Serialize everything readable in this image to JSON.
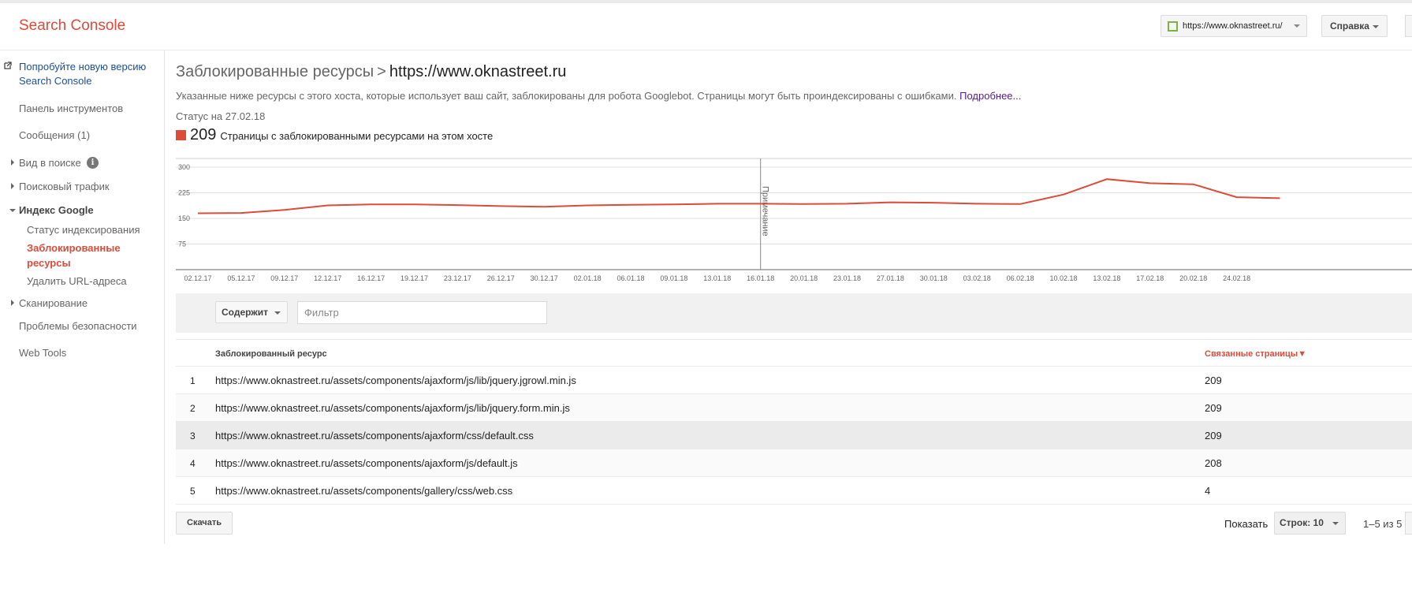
{
  "header": {
    "app_title": "Search Console",
    "site_selector": "https://www.oknastreet.ru/",
    "help_button": "Справка"
  },
  "sidebar": {
    "new_version_link": "Попробуйте новую версию Search Console",
    "dashboard": "Панель инструментов",
    "messages": "Сообщения (1)",
    "search_appearance": "Вид в поиске",
    "search_traffic": "Поисковый трафик",
    "google_index": "Индекс Google",
    "index_status": "Статус индексирования",
    "blocked_resources": "Заблокированные ресурсы",
    "remove_urls": "Удалить URL-адреса",
    "crawl": "Сканирование",
    "security_issues": "Проблемы безопасности",
    "web_tools": "Web Tools"
  },
  "page": {
    "title": "Заблокированные ресурсы",
    "separator": ">",
    "host": "https://www.oknastreet.ru",
    "description": "Указанные ниже ресурсы с этого хоста, которые использует ваш сайт, заблокированы для робота Googlebot. Страницы могут быть проиндексированы с ошибками.",
    "more_link": "Подробнее...",
    "status": "Статус на 27.02.18",
    "legend_count": "209",
    "legend_label": "Страницы с заблокированными ресурсами на этом хосте"
  },
  "chart_data": {
    "type": "line",
    "title": "",
    "xlabel": "",
    "ylabel": "",
    "ylim": [
      0,
      300
    ],
    "y_ticks": [
      "300",
      "225",
      "150",
      "75"
    ],
    "x_tick_labels": [
      "02.12.17",
      "05.12.17",
      "09.12.17",
      "12.12.17",
      "16.12.17",
      "19.12.17",
      "23.12.17",
      "26.12.17",
      "30.12.17",
      "02.01.18",
      "06.01.18",
      "09.01.18",
      "13.01.18",
      "16.01.18",
      "20.01.18",
      "23.01.18",
      "27.01.18",
      "30.01.18",
      "03.02.18",
      "06.02.18",
      "10.02.18",
      "13.02.18",
      "17.02.18",
      "20.02.18",
      "24.02.18"
    ],
    "annotation": {
      "at": "16.01.18",
      "label": "Примечание"
    },
    "color": "#dd4b39",
    "series": [
      {
        "x": [
          "02.12.17",
          "05.12.17",
          "09.12.17",
          "12.12.17",
          "16.12.17",
          "19.12.17",
          "23.12.17",
          "26.12.17",
          "30.12.17",
          "02.01.18",
          "06.01.18",
          "09.01.18",
          "13.01.18",
          "16.01.18",
          "20.01.18",
          "23.01.18",
          "27.01.18",
          "30.01.18",
          "03.02.18",
          "06.02.18",
          "10.02.18",
          "13.02.18",
          "17.02.18",
          "20.02.18",
          "24.02.18",
          "27.02.18"
        ],
        "values": [
          165,
          166,
          175,
          188,
          191,
          191,
          189,
          186,
          184,
          188,
          190,
          191,
          193,
          193,
          192,
          193,
          197,
          196,
          193,
          192,
          220,
          265,
          253,
          250,
          212,
          209
        ]
      }
    ]
  },
  "filter": {
    "mode": "Содержит",
    "placeholder": "Фильтр"
  },
  "table": {
    "col_resource": "Заблокированный ресурс",
    "col_pages": "Связанные страницы",
    "sort_indicator": "▼",
    "rows": [
      {
        "num": "1",
        "resource": "https://www.oknastreet.ru/assets/components/ajaxform/js/lib/jquery.jgrowl.min.js",
        "pages": "209"
      },
      {
        "num": "2",
        "resource": "https://www.oknastreet.ru/assets/components/ajaxform/js/lib/jquery.form.min.js",
        "pages": "209"
      },
      {
        "num": "3",
        "resource": "https://www.oknastreet.ru/assets/components/ajaxform/css/default.css",
        "pages": "209"
      },
      {
        "num": "4",
        "resource": "https://www.oknastreet.ru/assets/components/ajaxform/js/default.js",
        "pages": "208"
      },
      {
        "num": "5",
        "resource": "https://www.oknastreet.ru/assets/components/gallery/css/web.css",
        "pages": "4"
      }
    ]
  },
  "footer": {
    "download": "Скачать",
    "show_label": "Показать",
    "rows_select": "Строк: 10",
    "pager": "1–5 из 5"
  }
}
